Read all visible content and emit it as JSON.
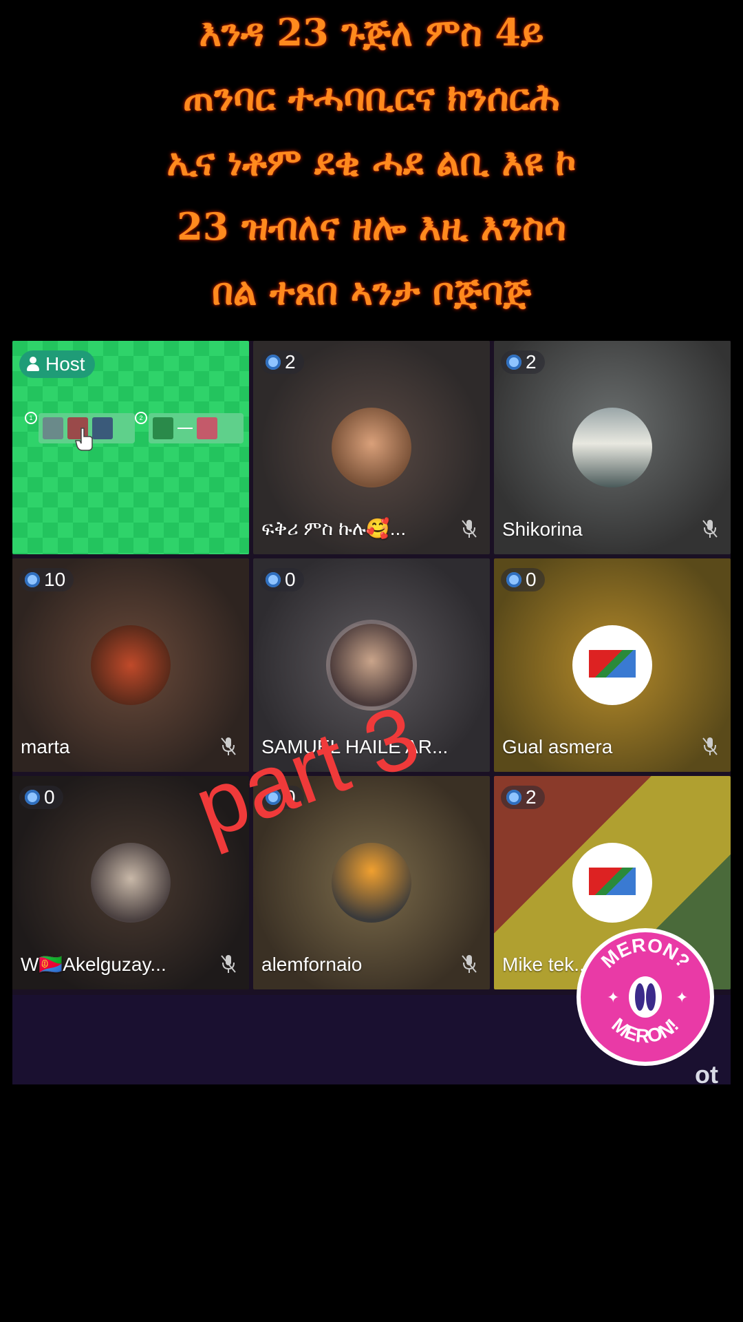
{
  "caption": {
    "lines": [
      "እንዳ 23  ጉጅለ ምስ 4ይ",
      "ጠንባር ተሓባቢርና ክንሰርሕ",
      "ኢና ነቶም ደቂ ሓደ ልቢ እዩ ኮ",
      "23  ዝብለና ዘሎ እዚ እንስሳ",
      "በል  ተጸበ ኣንታ ቦጅባጅ"
    ]
  },
  "host_tile": {
    "label": "Host",
    "steps": [
      "①",
      "②"
    ]
  },
  "participants": [
    {
      "count": "2",
      "name": "ፍቅሪ  ምስ  ኩሉ🥰...",
      "muted": true
    },
    {
      "count": "2",
      "name": "Shikorina",
      "muted": true
    },
    {
      "count": "10",
      "name": "marta",
      "muted": true
    },
    {
      "count": "0",
      "name": "SAMUEL HAILE AR...",
      "muted": false
    },
    {
      "count": "0",
      "name": "Gual asmera",
      "muted": true
    },
    {
      "count": "0",
      "name": "W🇪🇷Akelguzay...",
      "muted": true
    },
    {
      "count": "0",
      "name": "alemfornaio",
      "muted": true
    },
    {
      "count": "2",
      "name": "Mike tek...",
      "muted": false
    }
  ],
  "overlay": {
    "part_label": "part 3",
    "sticker_text": "MERON? MERON!",
    "corner_text": "ot"
  },
  "colors": {
    "caption": "#ff8a1e",
    "host_badge": "#1f9c77",
    "checker": "#23c45e",
    "part_label": "#f03a3a",
    "sticker": "#e93aa6"
  }
}
